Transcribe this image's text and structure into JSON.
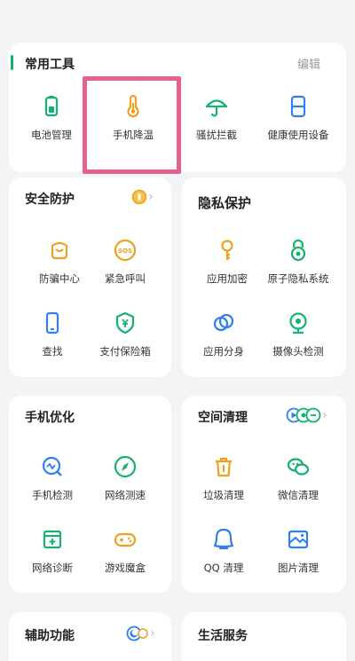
{
  "common_tools": {
    "title": "常用工具",
    "edit_label": "编辑",
    "items": [
      {
        "label": "电池管理",
        "icon": "battery-icon"
      },
      {
        "label": "手机降温",
        "icon": "thermometer-icon"
      },
      {
        "label": "骚扰拦截",
        "icon": "umbrella-icon"
      },
      {
        "label": "健康使用设备",
        "icon": "hourglass-icon"
      }
    ]
  },
  "security": {
    "title": "安全防护",
    "items": [
      {
        "label": "防骗中心",
        "icon": "anti-fraud-icon"
      },
      {
        "label": "紧急呼叫",
        "icon": "sos-icon"
      },
      {
        "label": "查找",
        "icon": "find-phone-icon"
      },
      {
        "label": "支付保险箱",
        "icon": "payment-shield-icon"
      }
    ]
  },
  "privacy": {
    "title": "隐私保护",
    "items": [
      {
        "label": "应用加密",
        "icon": "key-icon"
      },
      {
        "label": "原子隐私系统",
        "icon": "atom-lock-icon"
      },
      {
        "label": "应用分身",
        "icon": "app-clone-icon"
      },
      {
        "label": "摄像头检测",
        "icon": "camera-detect-icon"
      }
    ]
  },
  "optimization": {
    "title": "手机优化",
    "items": [
      {
        "label": "手机检测",
        "icon": "phone-scan-icon"
      },
      {
        "label": "网络测速",
        "icon": "compass-icon"
      },
      {
        "label": "网络诊断",
        "icon": "network-diagnose-icon"
      },
      {
        "label": "游戏魔盒",
        "icon": "gamepad-icon"
      }
    ]
  },
  "cleanup": {
    "title": "空间清理",
    "items": [
      {
        "label": "垃圾清理",
        "icon": "trash-icon"
      },
      {
        "label": "微信清理",
        "icon": "wechat-icon"
      },
      {
        "label": "QQ 清理",
        "icon": "qq-icon"
      },
      {
        "label": "图片清理",
        "icon": "image-icon"
      }
    ]
  },
  "assist": {
    "title": "辅助功能"
  },
  "life": {
    "title": "生活服务"
  },
  "colors": {
    "green": "#12b36b",
    "orange": "#f0a020",
    "blue": "#2f7ff0",
    "highlight": "#e46093"
  }
}
